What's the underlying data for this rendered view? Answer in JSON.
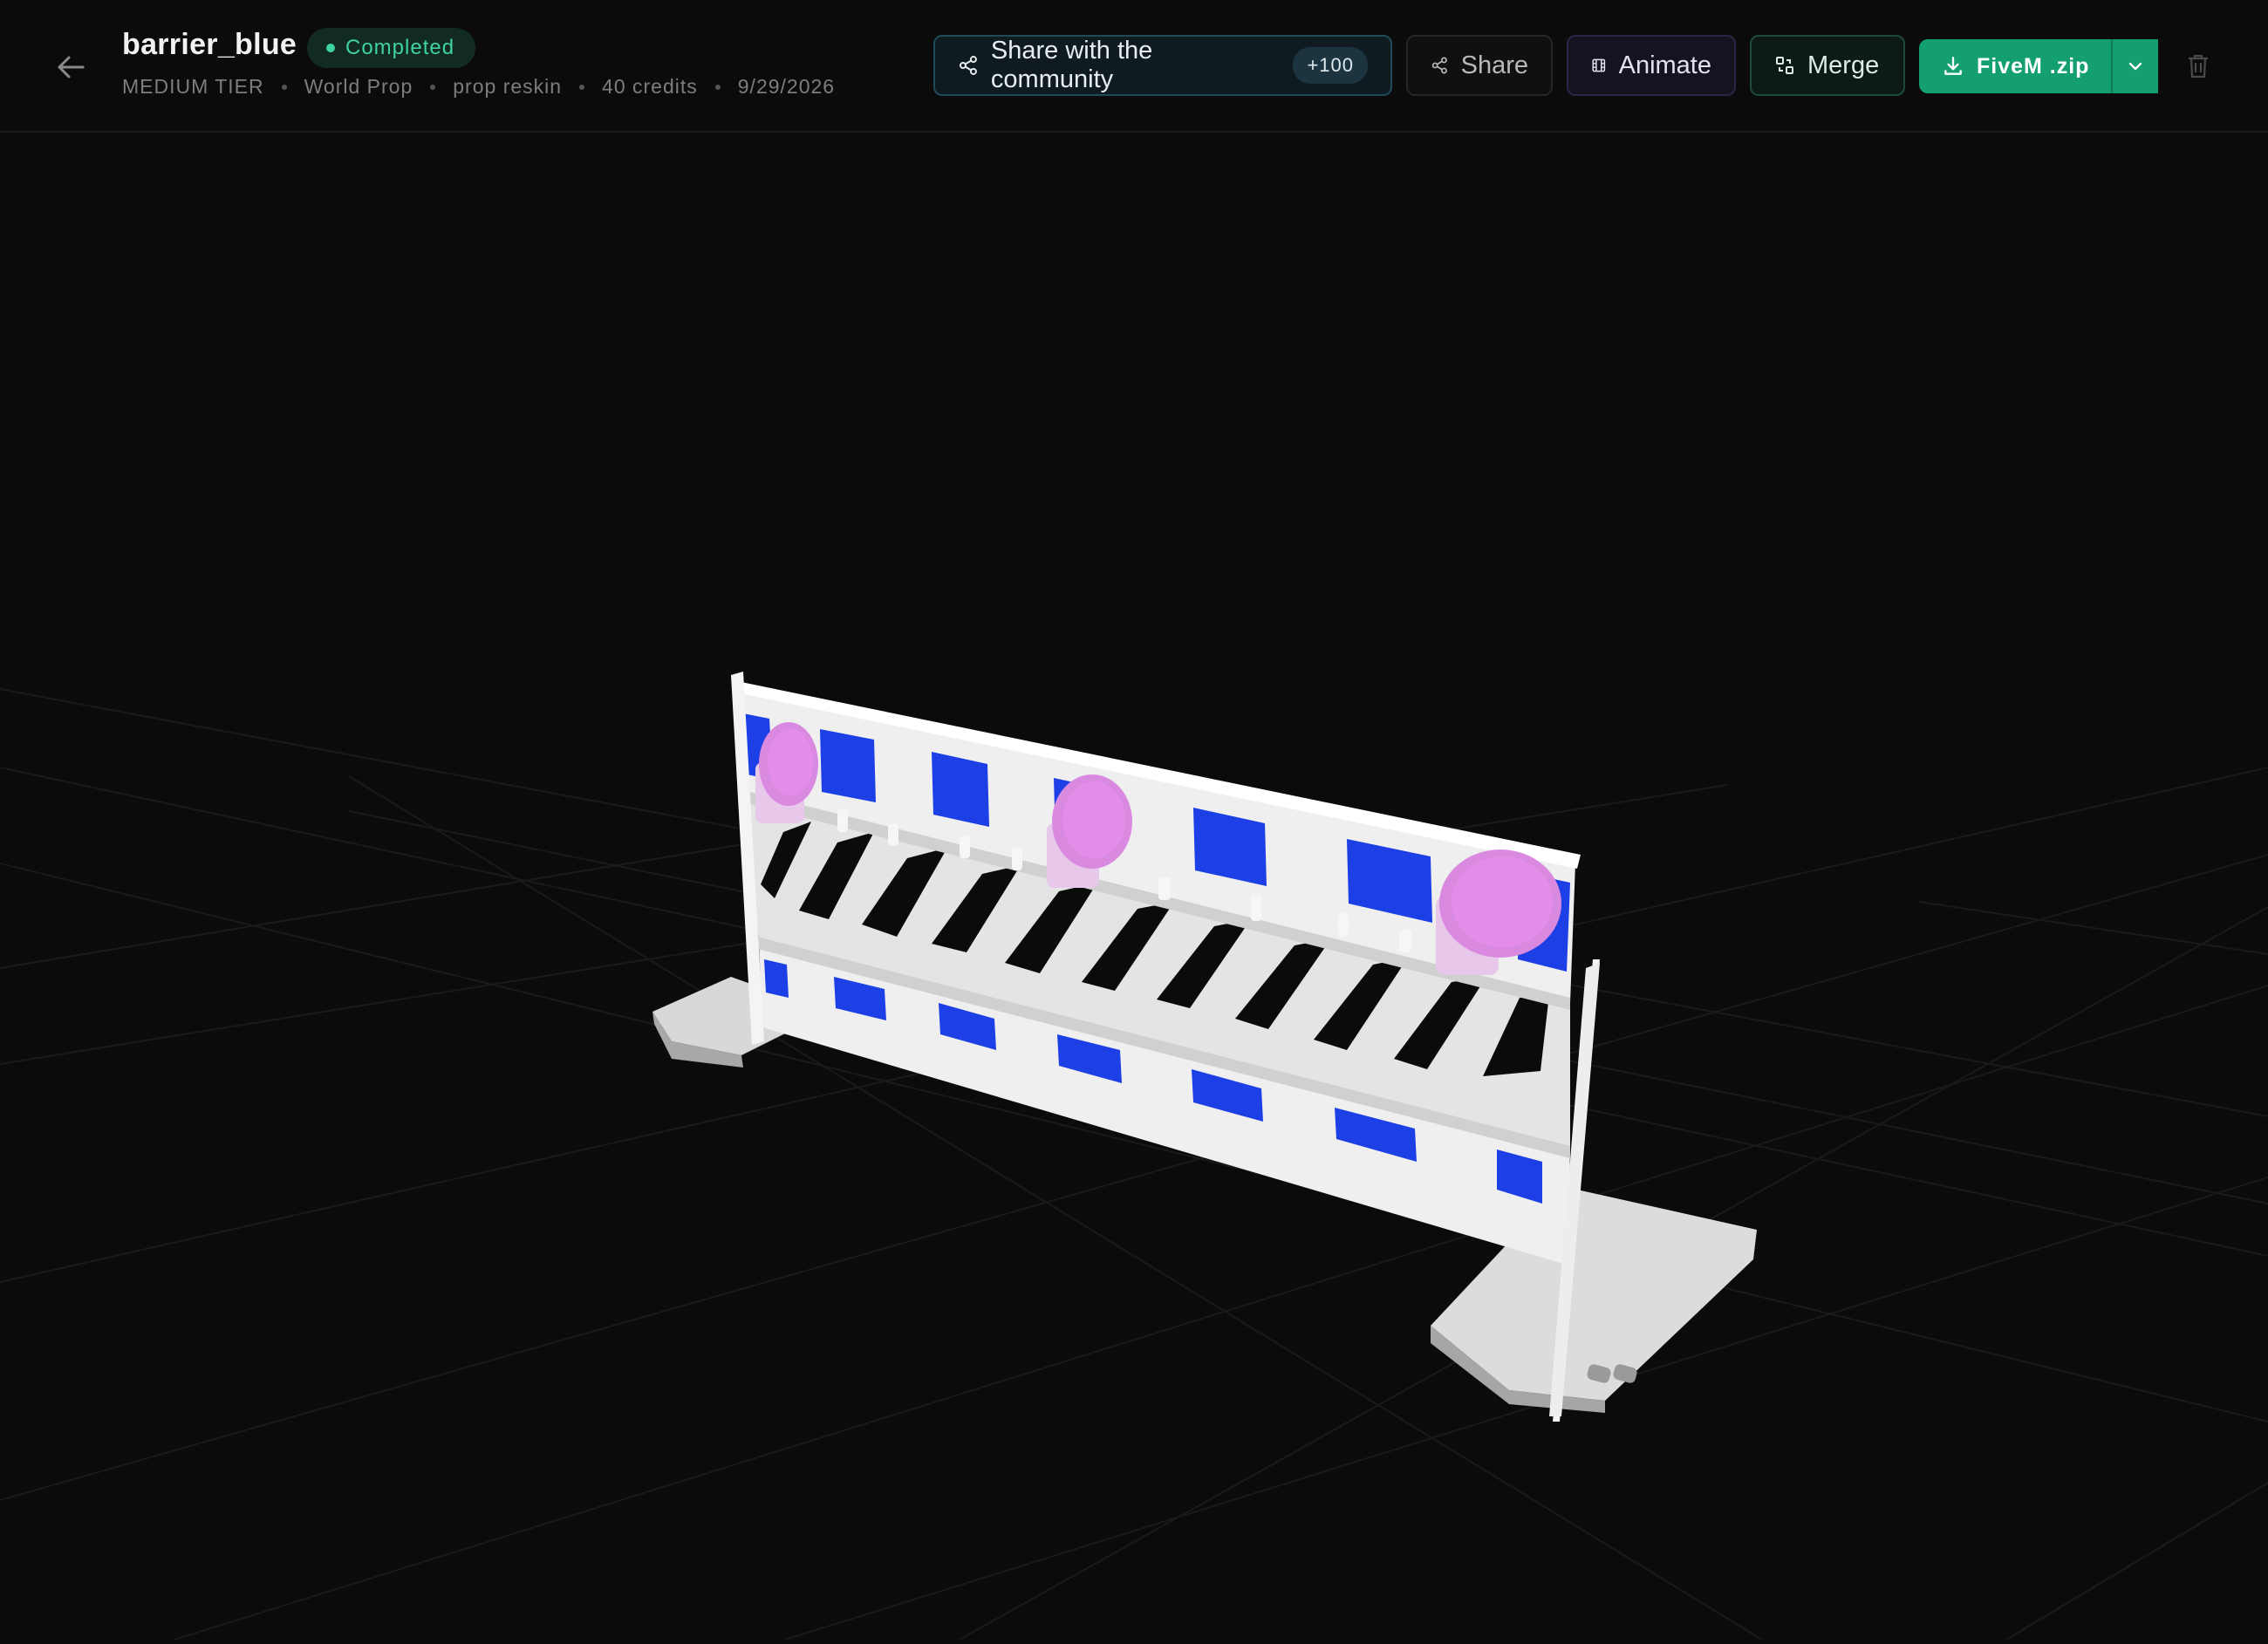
{
  "header": {
    "back_icon": "arrow-left-icon",
    "title": "barrier_blue",
    "status": "Completed",
    "status_color": "#3fd3a0",
    "meta": {
      "tier": "MEDIUM TIER",
      "category": "World Prop",
      "type": "prop reskin",
      "credits": "40 credits",
      "date": "9/29/2026"
    }
  },
  "toolbar": {
    "community_label": "Share with the community",
    "community_bonus": "+100",
    "share_label": "Share",
    "animate_label": "Animate",
    "merge_label": "Merge",
    "download_label": "FiveM .zip",
    "accent_color": "#13a06e",
    "icons": [
      "share-icon",
      "film-icon",
      "merge-icon",
      "download-icon",
      "chevron-down-icon",
      "trash-icon"
    ]
  },
  "viewport": {
    "model_name": "barrier_blue",
    "model_colors": {
      "body": "#f2f2f2",
      "stripes": "#1a3fe0",
      "lamps": "#e58de8"
    }
  }
}
